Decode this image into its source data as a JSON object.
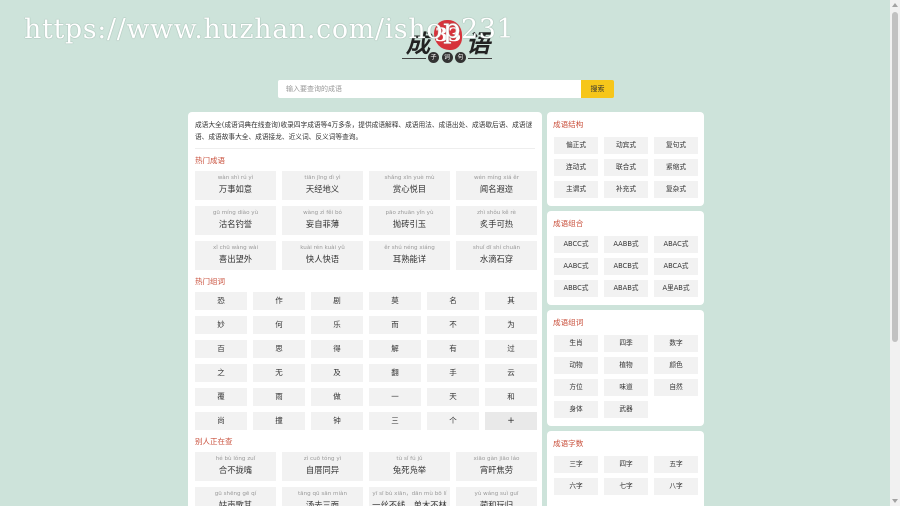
{
  "watermark": "https://www.huzhan.com/ishop231",
  "logo": {
    "char1": "成",
    "seal": "33",
    "char2": "语",
    "sub": [
      "子",
      "词",
      "句"
    ]
  },
  "search": {
    "placeholder": "输入要查询的成语",
    "button": "搜索"
  },
  "main": {
    "intro": "成语大全(成语词典在线查询)收录四字成语等4万多条，提供成语解释、成语用法、成语出处、成语歇后语、成语谜语、成语故事大全、成语接龙、近义词、反义词等查询。",
    "hot_idioms_title": "热门成语",
    "hot_idioms": [
      {
        "py": "wàn shì rú yì",
        "w": "万事如意"
      },
      {
        "py": "tiān jīng dì yì",
        "w": "天经地义"
      },
      {
        "py": "shǎng xīn yuè mù",
        "w": "赏心悦目"
      },
      {
        "py": "wén míng xiá ěr",
        "w": "闻名遐迩"
      },
      {
        "py": "gū míng diào yù",
        "w": "沽名钓誉"
      },
      {
        "py": "wàng zì fěi bó",
        "w": "妄自菲薄"
      },
      {
        "py": "pāo zhuān yǐn yù",
        "w": "抛砖引玉"
      },
      {
        "py": "zhì shǒu kě rè",
        "w": "炙手可热"
      },
      {
        "py": "xǐ chū wàng wài",
        "w": "喜出望外"
      },
      {
        "py": "kuài rén kuài yǔ",
        "w": "快人快语"
      },
      {
        "py": "ěr shú néng xiáng",
        "w": "耳熟能详"
      },
      {
        "py": "shuǐ dī shí chuān",
        "w": "水滴石穿"
      }
    ],
    "hot_words_title": "热门组词",
    "hot_words": [
      "恐",
      "作",
      "剧",
      "莫",
      "名",
      "其",
      "妙",
      "何",
      "乐",
      "而",
      "不",
      "为",
      "百",
      "思",
      "得",
      "解",
      "有",
      "过",
      "之",
      "无",
      "及",
      "翻",
      "手",
      "云",
      "覆",
      "雨",
      "做",
      "一",
      "天",
      "和",
      "尚",
      "撞",
      "钟",
      "三",
      "个",
      "+"
    ],
    "searching_title": "别人正在查",
    "searching": [
      {
        "py": "hé bù lǒng zuǐ",
        "w": "合不拢嘴"
      },
      {
        "py": "zì cuō tóng yì",
        "w": "自厝同异"
      },
      {
        "py": "tù sǐ fú jǔ",
        "w": "兔死凫举"
      },
      {
        "py": "xiāo gàn jiāo láo",
        "w": "宵旰焦劳"
      },
      {
        "py": "gū shēng gē qí",
        "w": "姑声歌其"
      },
      {
        "py": "tāng qū sān miàn",
        "w": "汤去三面"
      },
      {
        "py": "yī sī bù xiān，dān mù bō lí",
        "w": "一丝不线，单木不林"
      },
      {
        "py": "yù wáng suì guī",
        "w": "蔺和玩归"
      }
    ]
  },
  "side": {
    "structure": {
      "title": "成语结构",
      "items": [
        "偏正式",
        "动宾式",
        "复句式",
        "连动式",
        "联合式",
        "紧缩式",
        "主谓式",
        "补充式",
        "复杂式"
      ]
    },
    "combo": {
      "title": "成语组合",
      "items": [
        "ABCC式",
        "AABB式",
        "ABAC式",
        "AABC式",
        "ABCB式",
        "ABCA式",
        "ABBC式",
        "ABAB式",
        "A里AB式"
      ]
    },
    "groupwords": {
      "title": "成语组词",
      "items": [
        "生肖",
        "四季",
        "数字",
        "动物",
        "植物",
        "颜色",
        "方位",
        "味道",
        "自然",
        "身体",
        "武器"
      ]
    },
    "count": {
      "title": "成语字数",
      "items": [
        "三字",
        "四字",
        "五字",
        "六字",
        "七字",
        "八字"
      ]
    }
  }
}
